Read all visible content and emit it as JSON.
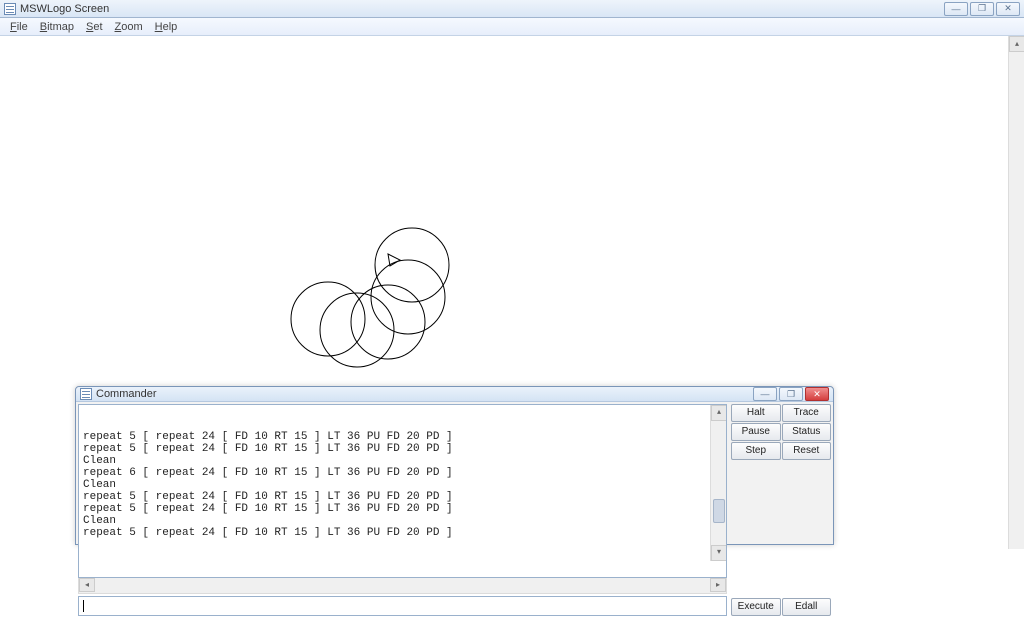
{
  "window": {
    "title": "MSWLogo Screen",
    "buttons": {
      "min": "—",
      "max": "❐",
      "close": "✕"
    }
  },
  "menu": {
    "file": "File",
    "bitmap": "Bitmap",
    "set": "Set",
    "zoom": "Zoom",
    "help": "Help"
  },
  "commander": {
    "title": "Commander",
    "history": [
      "repeat 5 [ repeat 24 [ FD 10 RT 15 ] LT 36 PU FD 20 PD ]",
      "repeat 5 [ repeat 24 [ FD 10 RT 15 ] LT 36 PU FD 20 PD ]",
      "Clean",
      "repeat 6 [ repeat 24 [ FD 10 RT 15 ] LT 36 PU FD 20 PD ]",
      "Clean",
      "repeat 5 [ repeat 24 [ FD 10 RT 15 ] LT 36 PU FD 20 PD ]",
      "repeat 5 [ repeat 24 [ FD 10 RT 15 ] LT 36 PU FD 20 PD ]",
      "Clean",
      "repeat 5 [ repeat 24 [ FD 10 RT 15 ] LT 36 PU FD 20 PD ]"
    ],
    "input": "",
    "buttons": {
      "halt": "Halt",
      "trace": "Trace",
      "pause": "Pause",
      "status": "Status",
      "step": "Step",
      "reset": "Reset",
      "execute": "Execute",
      "edall": "Edall"
    },
    "winbtns": {
      "min": "—",
      "max": "❐",
      "close": "✕"
    }
  }
}
